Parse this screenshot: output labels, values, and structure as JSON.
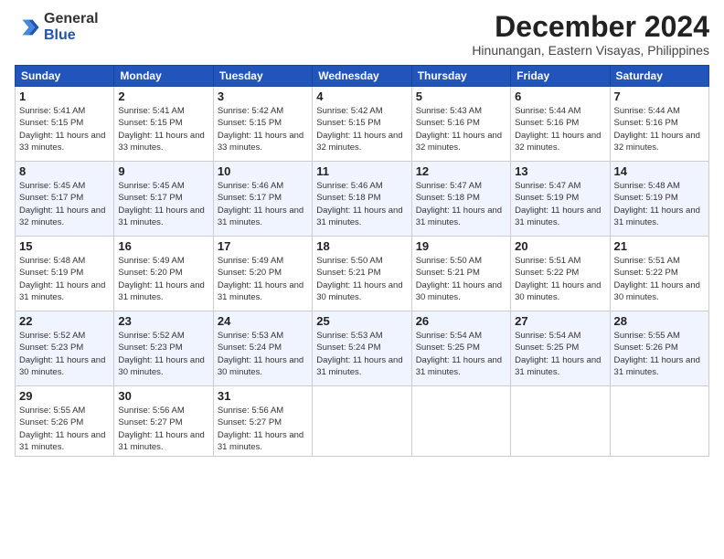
{
  "header": {
    "logo_general": "General",
    "logo_blue": "Blue",
    "month_title": "December 2024",
    "location": "Hinunangan, Eastern Visayas, Philippines"
  },
  "weekdays": [
    "Sunday",
    "Monday",
    "Tuesday",
    "Wednesday",
    "Thursday",
    "Friday",
    "Saturday"
  ],
  "weeks": [
    [
      {
        "day": "1",
        "sunrise": "Sunrise: 5:41 AM",
        "sunset": "Sunset: 5:15 PM",
        "daylight": "Daylight: 11 hours and 33 minutes."
      },
      {
        "day": "2",
        "sunrise": "Sunrise: 5:41 AM",
        "sunset": "Sunset: 5:15 PM",
        "daylight": "Daylight: 11 hours and 33 minutes."
      },
      {
        "day": "3",
        "sunrise": "Sunrise: 5:42 AM",
        "sunset": "Sunset: 5:15 PM",
        "daylight": "Daylight: 11 hours and 33 minutes."
      },
      {
        "day": "4",
        "sunrise": "Sunrise: 5:42 AM",
        "sunset": "Sunset: 5:15 PM",
        "daylight": "Daylight: 11 hours and 32 minutes."
      },
      {
        "day": "5",
        "sunrise": "Sunrise: 5:43 AM",
        "sunset": "Sunset: 5:16 PM",
        "daylight": "Daylight: 11 hours and 32 minutes."
      },
      {
        "day": "6",
        "sunrise": "Sunrise: 5:44 AM",
        "sunset": "Sunset: 5:16 PM",
        "daylight": "Daylight: 11 hours and 32 minutes."
      },
      {
        "day": "7",
        "sunrise": "Sunrise: 5:44 AM",
        "sunset": "Sunset: 5:16 PM",
        "daylight": "Daylight: 11 hours and 32 minutes."
      }
    ],
    [
      {
        "day": "8",
        "sunrise": "Sunrise: 5:45 AM",
        "sunset": "Sunset: 5:17 PM",
        "daylight": "Daylight: 11 hours and 32 minutes."
      },
      {
        "day": "9",
        "sunrise": "Sunrise: 5:45 AM",
        "sunset": "Sunset: 5:17 PM",
        "daylight": "Daylight: 11 hours and 31 minutes."
      },
      {
        "day": "10",
        "sunrise": "Sunrise: 5:46 AM",
        "sunset": "Sunset: 5:17 PM",
        "daylight": "Daylight: 11 hours and 31 minutes."
      },
      {
        "day": "11",
        "sunrise": "Sunrise: 5:46 AM",
        "sunset": "Sunset: 5:18 PM",
        "daylight": "Daylight: 11 hours and 31 minutes."
      },
      {
        "day": "12",
        "sunrise": "Sunrise: 5:47 AM",
        "sunset": "Sunset: 5:18 PM",
        "daylight": "Daylight: 11 hours and 31 minutes."
      },
      {
        "day": "13",
        "sunrise": "Sunrise: 5:47 AM",
        "sunset": "Sunset: 5:19 PM",
        "daylight": "Daylight: 11 hours and 31 minutes."
      },
      {
        "day": "14",
        "sunrise": "Sunrise: 5:48 AM",
        "sunset": "Sunset: 5:19 PM",
        "daylight": "Daylight: 11 hours and 31 minutes."
      }
    ],
    [
      {
        "day": "15",
        "sunrise": "Sunrise: 5:48 AM",
        "sunset": "Sunset: 5:19 PM",
        "daylight": "Daylight: 11 hours and 31 minutes."
      },
      {
        "day": "16",
        "sunrise": "Sunrise: 5:49 AM",
        "sunset": "Sunset: 5:20 PM",
        "daylight": "Daylight: 11 hours and 31 minutes."
      },
      {
        "day": "17",
        "sunrise": "Sunrise: 5:49 AM",
        "sunset": "Sunset: 5:20 PM",
        "daylight": "Daylight: 11 hours and 31 minutes."
      },
      {
        "day": "18",
        "sunrise": "Sunrise: 5:50 AM",
        "sunset": "Sunset: 5:21 PM",
        "daylight": "Daylight: 11 hours and 30 minutes."
      },
      {
        "day": "19",
        "sunrise": "Sunrise: 5:50 AM",
        "sunset": "Sunset: 5:21 PM",
        "daylight": "Daylight: 11 hours and 30 minutes."
      },
      {
        "day": "20",
        "sunrise": "Sunrise: 5:51 AM",
        "sunset": "Sunset: 5:22 PM",
        "daylight": "Daylight: 11 hours and 30 minutes."
      },
      {
        "day": "21",
        "sunrise": "Sunrise: 5:51 AM",
        "sunset": "Sunset: 5:22 PM",
        "daylight": "Daylight: 11 hours and 30 minutes."
      }
    ],
    [
      {
        "day": "22",
        "sunrise": "Sunrise: 5:52 AM",
        "sunset": "Sunset: 5:23 PM",
        "daylight": "Daylight: 11 hours and 30 minutes."
      },
      {
        "day": "23",
        "sunrise": "Sunrise: 5:52 AM",
        "sunset": "Sunset: 5:23 PM",
        "daylight": "Daylight: 11 hours and 30 minutes."
      },
      {
        "day": "24",
        "sunrise": "Sunrise: 5:53 AM",
        "sunset": "Sunset: 5:24 PM",
        "daylight": "Daylight: 11 hours and 30 minutes."
      },
      {
        "day": "25",
        "sunrise": "Sunrise: 5:53 AM",
        "sunset": "Sunset: 5:24 PM",
        "daylight": "Daylight: 11 hours and 31 minutes."
      },
      {
        "day": "26",
        "sunrise": "Sunrise: 5:54 AM",
        "sunset": "Sunset: 5:25 PM",
        "daylight": "Daylight: 11 hours and 31 minutes."
      },
      {
        "day": "27",
        "sunrise": "Sunrise: 5:54 AM",
        "sunset": "Sunset: 5:25 PM",
        "daylight": "Daylight: 11 hours and 31 minutes."
      },
      {
        "day": "28",
        "sunrise": "Sunrise: 5:55 AM",
        "sunset": "Sunset: 5:26 PM",
        "daylight": "Daylight: 11 hours and 31 minutes."
      }
    ],
    [
      {
        "day": "29",
        "sunrise": "Sunrise: 5:55 AM",
        "sunset": "Sunset: 5:26 PM",
        "daylight": "Daylight: 11 hours and 31 minutes."
      },
      {
        "day": "30",
        "sunrise": "Sunrise: 5:56 AM",
        "sunset": "Sunset: 5:27 PM",
        "daylight": "Daylight: 11 hours and 31 minutes."
      },
      {
        "day": "31",
        "sunrise": "Sunrise: 5:56 AM",
        "sunset": "Sunset: 5:27 PM",
        "daylight": "Daylight: 11 hours and 31 minutes."
      },
      null,
      null,
      null,
      null
    ]
  ]
}
